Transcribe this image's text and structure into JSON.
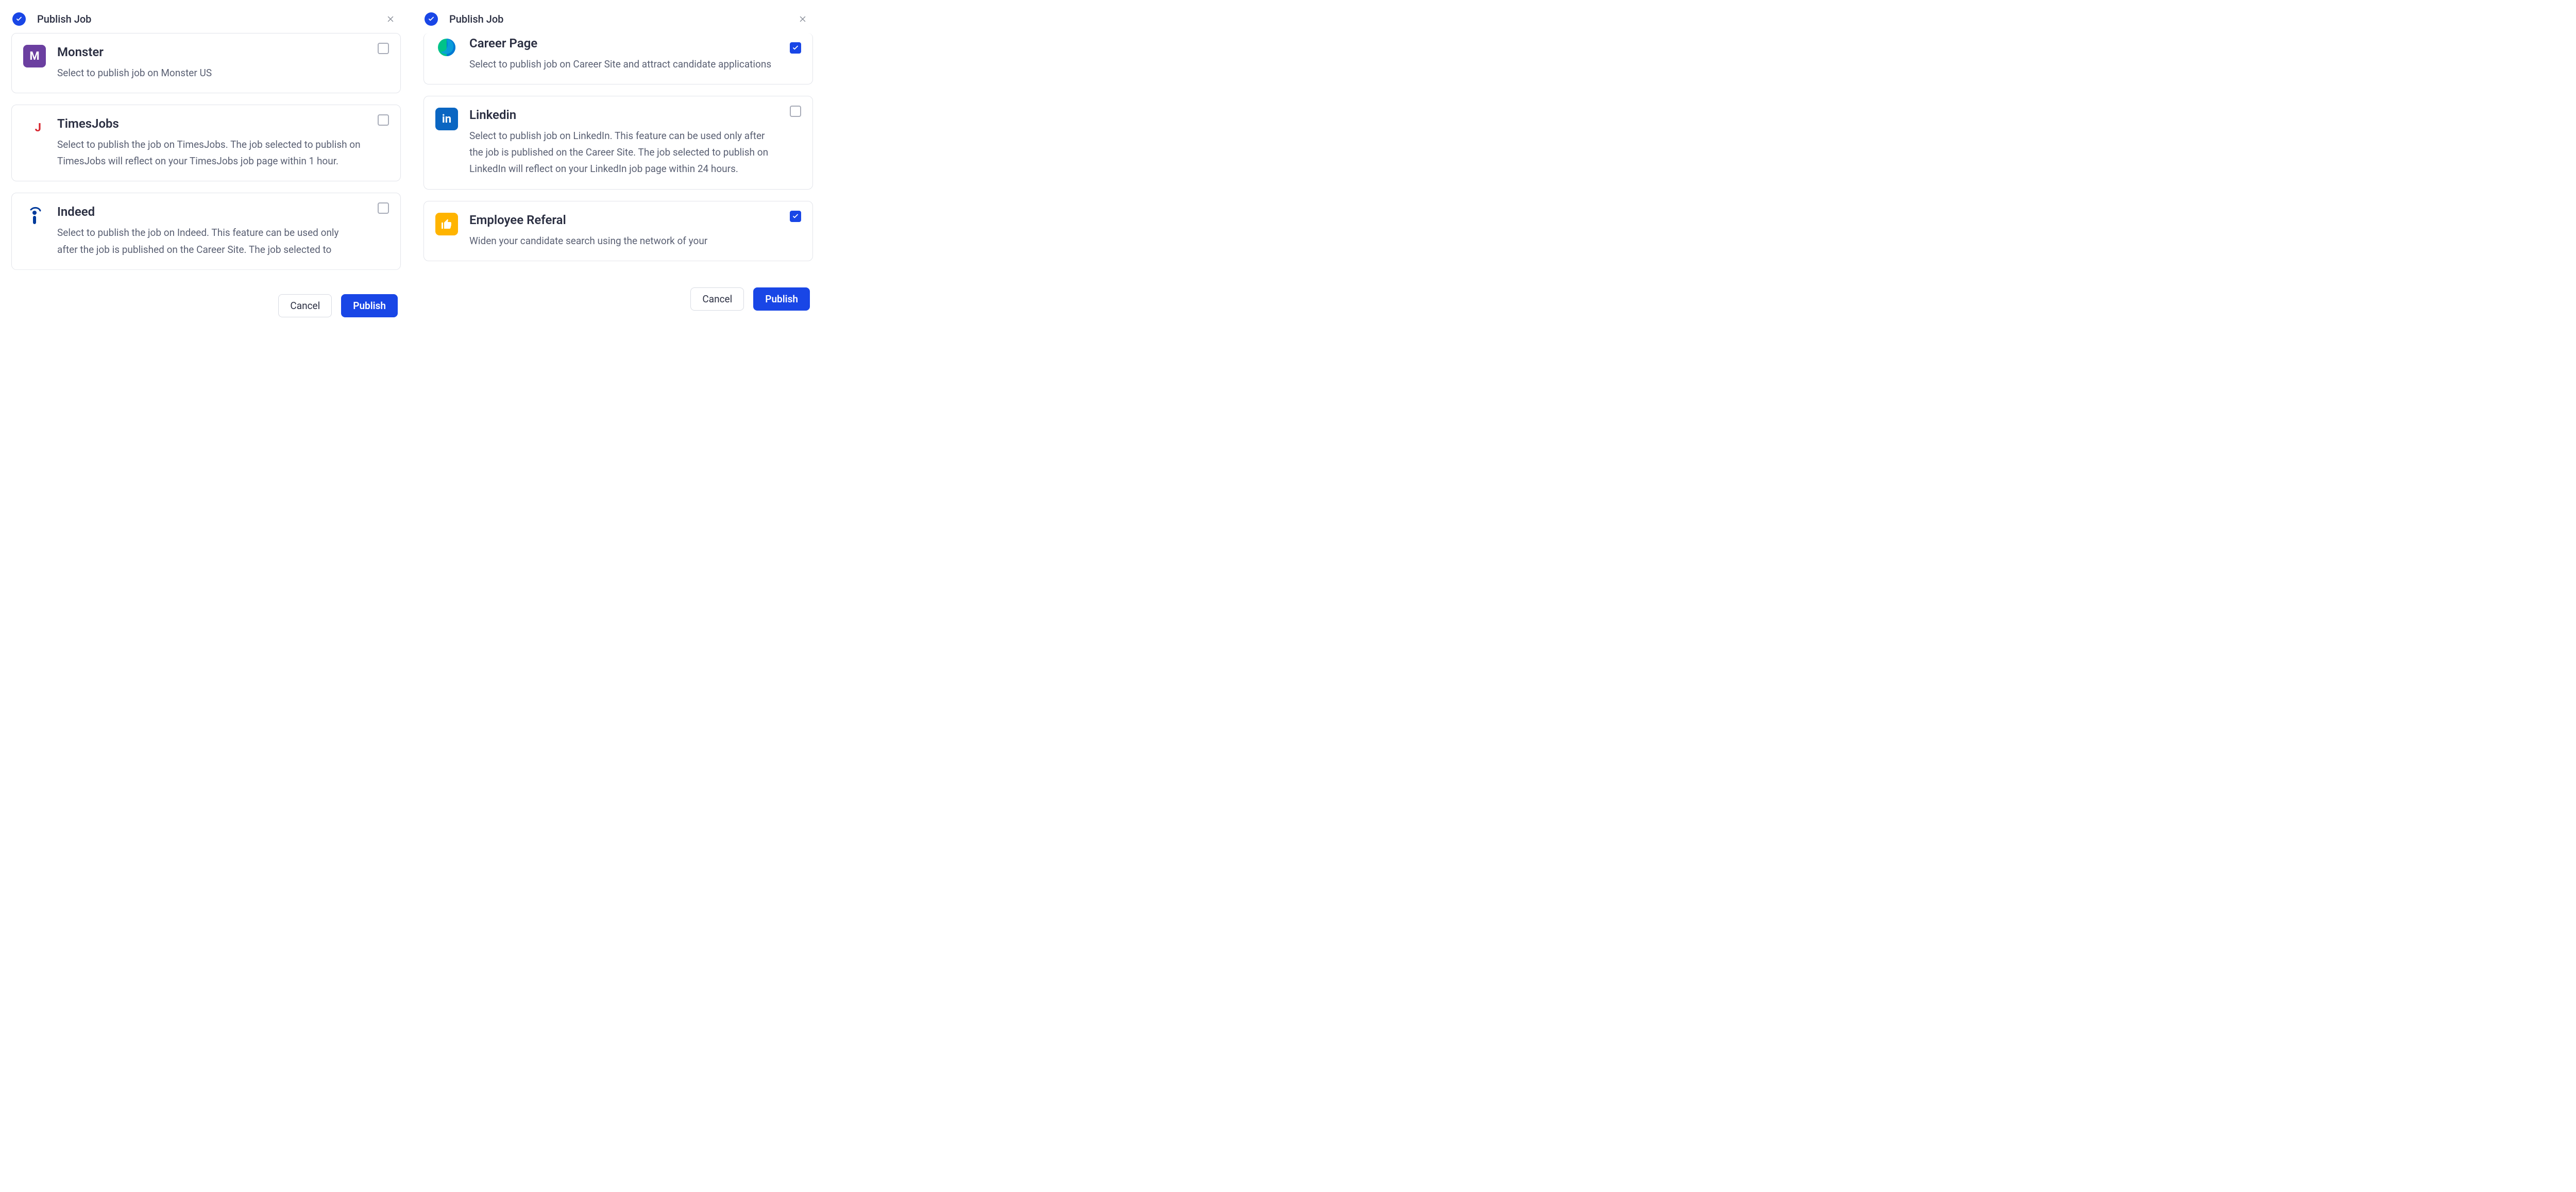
{
  "dialogs": [
    {
      "title": "Publish Job",
      "cancel": "Cancel",
      "publish": "Publish",
      "options": [
        {
          "logo": "monster",
          "name": "Monster",
          "desc": "Select to publish job on Monster US",
          "checked": false
        },
        {
          "logo": "timesjobs",
          "name": "TimesJobs",
          "desc": "Select to publish the job on TimesJobs. The job selected to publish on TimesJobs will reflect on your TimesJobs job page within 1 hour.",
          "checked": false
        },
        {
          "logo": "indeed",
          "name": "Indeed",
          "desc": "Select to publish the job on Indeed. This feature can be used only after the job is published on the Career Site. The job selected to",
          "checked": false
        }
      ]
    },
    {
      "title": "Publish Job",
      "cancel": "Cancel",
      "publish": "Publish",
      "options": [
        {
          "logo": "career",
          "name": "Career Page",
          "desc": "Select to publish job on Career Site and attract candidate applications",
          "checked": true
        },
        {
          "logo": "linkedin",
          "name": "Linkedin",
          "desc": "Select to publish job on LinkedIn. This feature can be used only after the job is published on the Career Site. The job selected to publish on LinkedIn will reflect on your LinkedIn job page within 24 hours.",
          "checked": false
        },
        {
          "logo": "referral",
          "name": "Employee Referal",
          "desc": "Widen your candidate search using the network of your",
          "checked": true
        }
      ]
    }
  ]
}
